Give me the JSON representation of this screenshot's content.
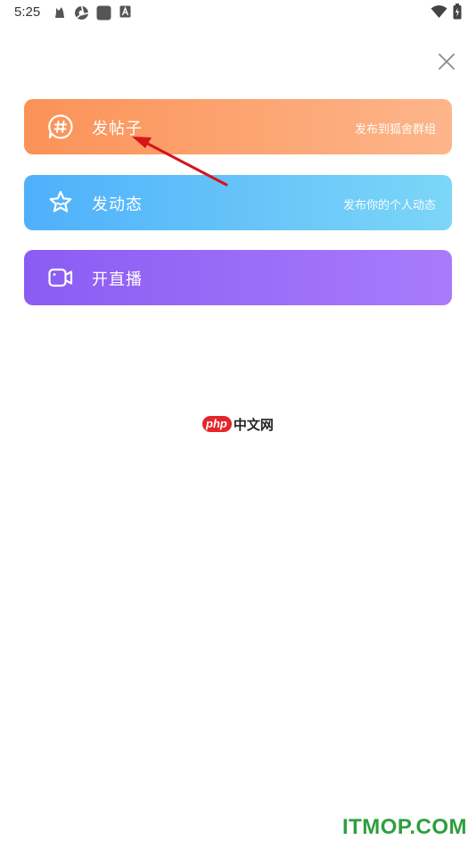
{
  "status_bar": {
    "time": "5:25",
    "icons": [
      "notification-icon",
      "app-icon",
      "square-icon",
      "a-icon",
      "wifi-icon",
      "battery-icon"
    ]
  },
  "close": {
    "icon": "close-icon"
  },
  "actions": [
    {
      "id": "post",
      "icon": "hashtag-bubble-icon",
      "title": "发帖子",
      "subtitle": "发布到狐舍群组",
      "gradient": [
        "#fb9257",
        "#fdb58a"
      ]
    },
    {
      "id": "dynamic",
      "icon": "star-icon",
      "title": "发动态",
      "subtitle": "发布你的个人动态",
      "gradient": [
        "#4fb0fb",
        "#7cd6f7"
      ]
    },
    {
      "id": "live",
      "icon": "video-camera-icon",
      "title": "开直播",
      "subtitle": "",
      "gradient": [
        "#8b5cf3",
        "#a97bfb"
      ]
    }
  ],
  "annotation": {
    "arrow_color": "#d4161c"
  },
  "watermarks": {
    "php_pill": "php",
    "php_text": "中文网",
    "site": "ITMOP.COM",
    "site_color": "#2e9e3e"
  }
}
